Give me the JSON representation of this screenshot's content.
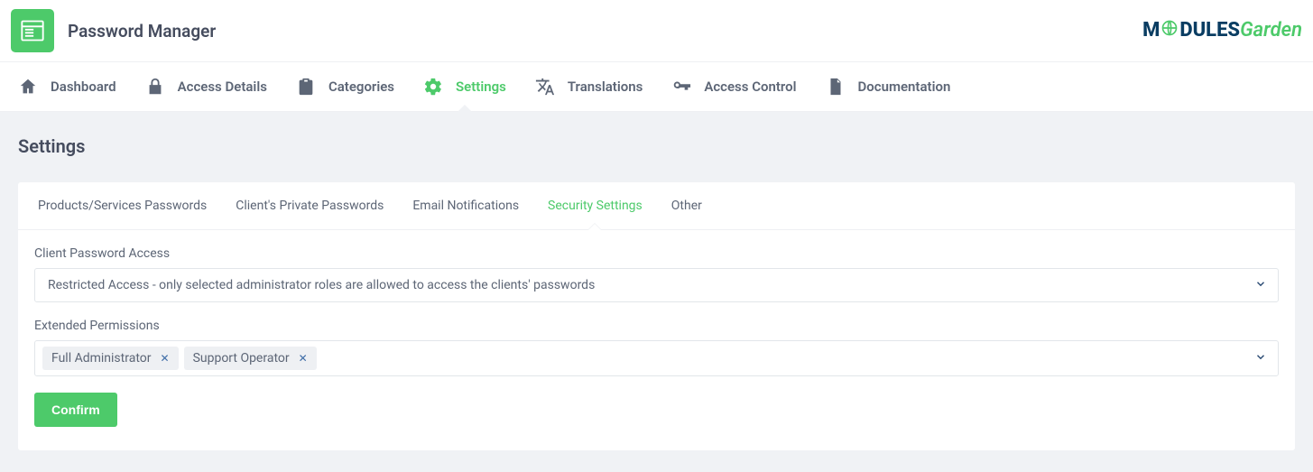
{
  "header": {
    "app_title": "Password Manager",
    "brand_left": "M",
    "brand_mid": "DULES",
    "brand_right": "Garden"
  },
  "nav": {
    "items": [
      {
        "label": "Dashboard"
      },
      {
        "label": "Access Details"
      },
      {
        "label": "Categories"
      },
      {
        "label": "Settings"
      },
      {
        "label": "Translations"
      },
      {
        "label": "Access Control"
      },
      {
        "label": "Documentation"
      }
    ],
    "active_index": 3
  },
  "page": {
    "title": "Settings"
  },
  "tabs": {
    "items": [
      {
        "label": "Products/Services Passwords"
      },
      {
        "label": "Client's Private Passwords"
      },
      {
        "label": "Email Notifications"
      },
      {
        "label": "Security Settings"
      },
      {
        "label": "Other"
      }
    ],
    "active_index": 3
  },
  "form": {
    "client_password_access": {
      "label": "Client Password Access",
      "value": "Restricted Access - only selected administrator roles are allowed to access the clients' passwords"
    },
    "extended_permissions": {
      "label": "Extended Permissions",
      "tags": [
        "Full Administrator",
        "Support Operator"
      ]
    },
    "confirm_label": "Confirm"
  },
  "colors": {
    "accent": "#4dca6a",
    "text": "#5d6676",
    "border": "#e2e6ea",
    "page_bg": "#f0f2f5"
  }
}
